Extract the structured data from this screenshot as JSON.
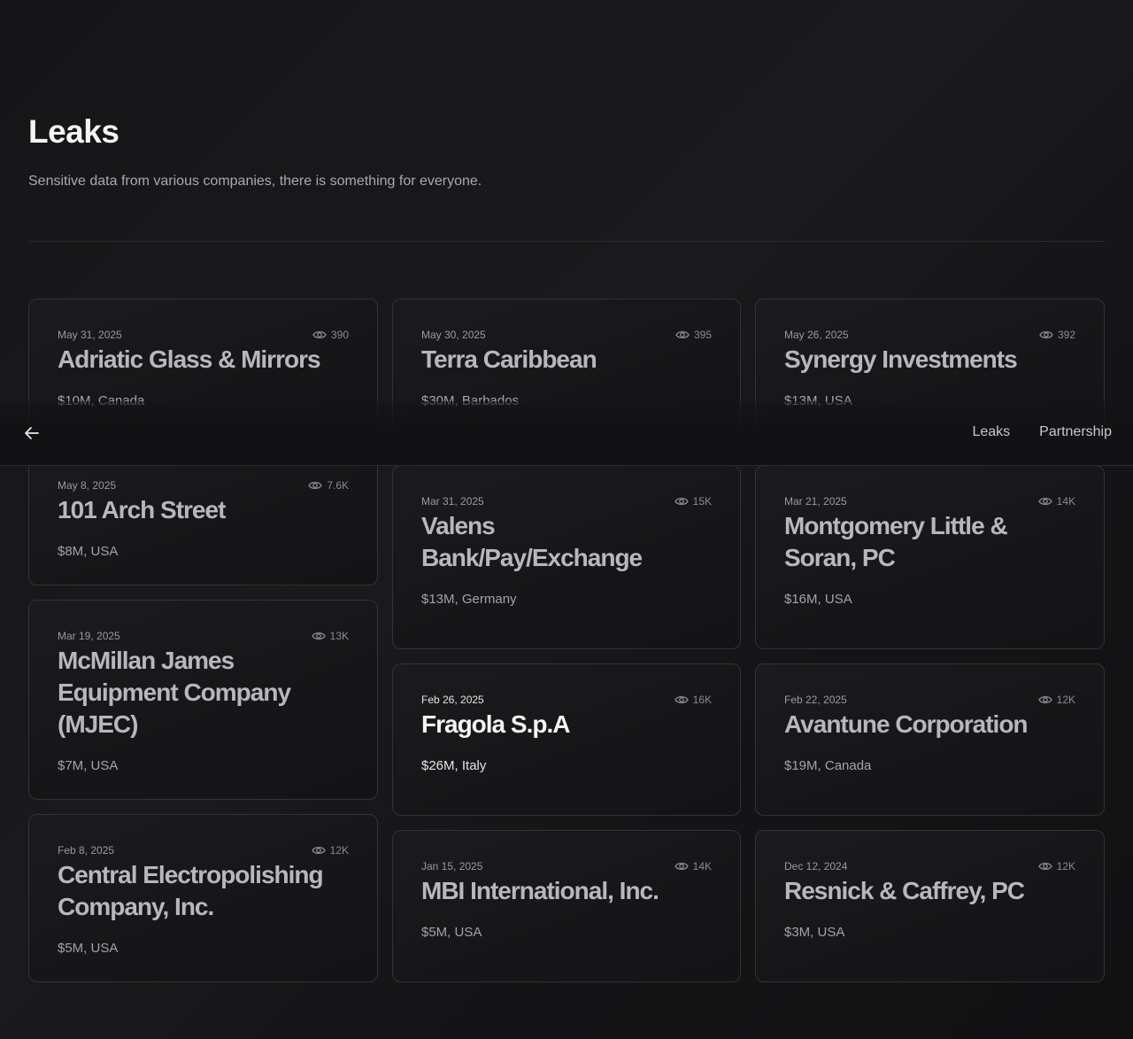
{
  "header": {
    "title": "Leaks",
    "subtitle": "Sensitive data from various companies, there is something for everyone."
  },
  "nav": {
    "links": [
      "Leaks",
      "Partnership"
    ]
  },
  "icons": {
    "back": "arrow-left-icon",
    "views": "eye-icon"
  },
  "cards": [
    {
      "date": "May 31, 2025",
      "views": "390",
      "name": "Adriatic Glass & Mirrors",
      "meta": "$10M, Canada"
    },
    {
      "date": "May 30, 2025",
      "views": "395",
      "name": "Terra Caribbean",
      "meta": "$30M, Barbados"
    },
    {
      "date": "May 26, 2025",
      "views": "392",
      "name": "Synergy Investments",
      "meta": "$13M, USA"
    },
    {
      "date": "May 8, 2025",
      "views": "7.6K",
      "name": "101 Arch Street",
      "meta": "$8M, USA"
    },
    {
      "date": "Mar 31, 2025",
      "views": "15K",
      "name": "Valens Bank/Pay/Exchange",
      "meta": "$13M, Germany"
    },
    {
      "date": "Mar 21, 2025",
      "views": "14K",
      "name": "Montgomery Little & Soran, PC",
      "meta": "$16M, USA"
    },
    {
      "date": "Mar 19, 2025",
      "views": "13K",
      "name": "McMillan James Equipment Company (MJEC)",
      "meta": "$7M, USA"
    },
    {
      "date": "Feb 26, 2025",
      "views": "16K",
      "name": "Fragola S.p.A",
      "meta": "$26M, Italy"
    },
    {
      "date": "Feb 22, 2025",
      "views": "12K",
      "name": "Avantune Corporation",
      "meta": "$19M, Canada"
    },
    {
      "date": "Feb 8, 2025",
      "views": "12K",
      "name": "Central Electropolishing Company, Inc.",
      "meta": "$5M, USA"
    },
    {
      "date": "Jan 15, 2025",
      "views": "14K",
      "name": "MBI International, Inc.",
      "meta": "$5M, USA"
    },
    {
      "date": "Dec 12, 2024",
      "views": "12K",
      "name": "Resnick & Caffrey, PC",
      "meta": "$3M, USA"
    }
  ]
}
